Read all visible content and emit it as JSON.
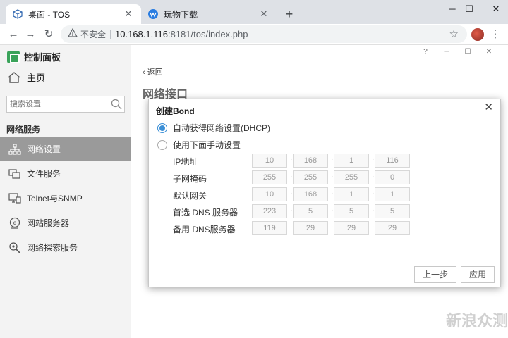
{
  "browser": {
    "tabs": [
      {
        "title": "桌面 - TOS",
        "active": true
      },
      {
        "title": "玩物下载",
        "active": false
      }
    ],
    "address": {
      "security_label": "不安全",
      "host": "10.168.1.116",
      "path": ":8181/tos/index.php"
    }
  },
  "sidebar": {
    "app_title": "控制面板",
    "home_label": "主页",
    "search_placeholder": "搜索设置",
    "section_title": "网络服务",
    "items": [
      {
        "label": "网络设置",
        "icon": "network-icon",
        "selected": true
      },
      {
        "label": "文件服务",
        "icon": "file-service-icon",
        "selected": false
      },
      {
        "label": "Telnet与SNMP",
        "icon": "monitor-icon",
        "selected": false
      },
      {
        "label": "网站服务器",
        "icon": "web-server-icon",
        "selected": false
      },
      {
        "label": "网络探索服务",
        "icon": "search-service-icon",
        "selected": false
      }
    ]
  },
  "main": {
    "window_controls": [
      "?",
      "─",
      "☐",
      "✕"
    ],
    "back_label": "返回",
    "page_title": "网络接口"
  },
  "dialog": {
    "title": "创建Bond",
    "radio_options": [
      {
        "label": "自动获得网络设置(DHCP)",
        "checked": true
      },
      {
        "label": "使用下面手动设置",
        "checked": false
      }
    ],
    "fields": [
      {
        "label": "IP地址",
        "octets": [
          "10",
          "168",
          "1",
          "116"
        ]
      },
      {
        "label": "子网掩码",
        "octets": [
          "255",
          "255",
          "255",
          "0"
        ]
      },
      {
        "label": "默认网关",
        "octets": [
          "10",
          "168",
          "1",
          "1"
        ]
      },
      {
        "label": "首选 DNS 服务器",
        "octets": [
          "223",
          "5",
          "5",
          "5"
        ]
      },
      {
        "label": "备用 DNS服务器",
        "octets": [
          "119",
          "29",
          "29",
          "29"
        ]
      }
    ],
    "prev_label": "上一步",
    "apply_label": "应用"
  },
  "watermark": "新浪众测",
  "colors": {
    "accent": "#3b8fd6",
    "sidebar_selected": "#9a9a9a",
    "logo_green": "#3aa35a"
  }
}
